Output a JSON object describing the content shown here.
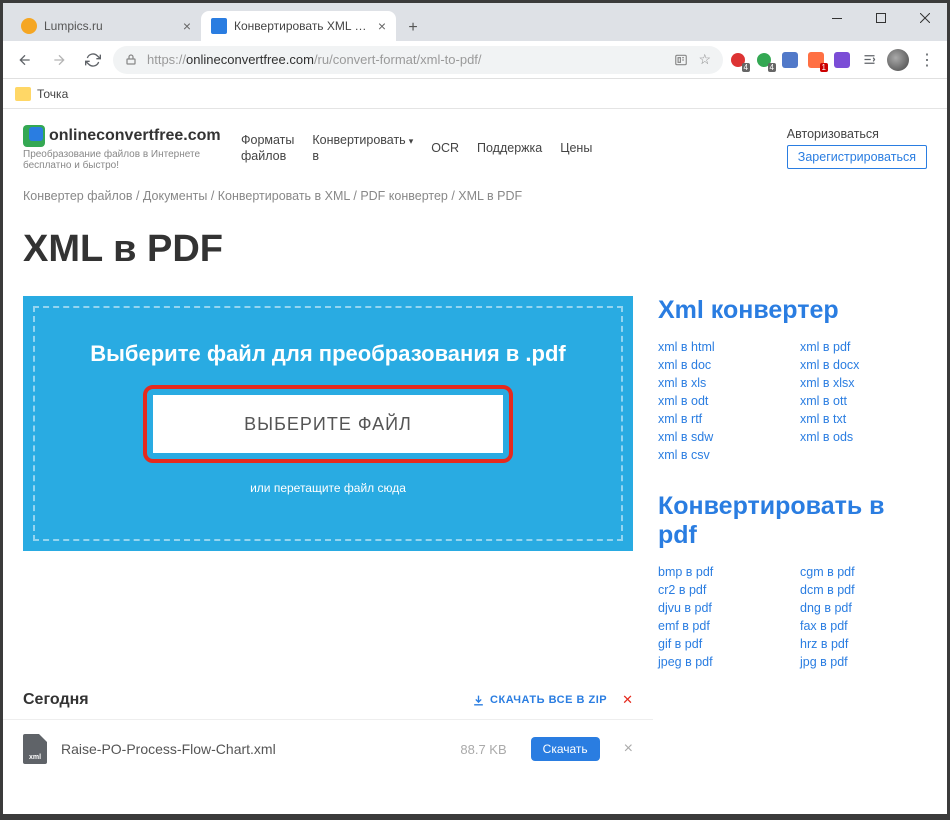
{
  "browser": {
    "tabs": [
      {
        "title": "Lumpics.ru"
      },
      {
        "title": "Конвертировать XML в PDF онл"
      }
    ],
    "url_scheme": "https://",
    "url_host": "onlineconvertfree.com",
    "url_path": "/ru/convert-format/xml-to-pdf/",
    "bookmark": "Точка",
    "ext_badges": {
      "b1": "4",
      "b2": "4",
      "b3": "1"
    }
  },
  "header": {
    "logo": "onlineconvertfree.com",
    "tagline": "Преобразование файлов в Интернете бесплатно и быстро!",
    "nav": {
      "formats1": "Форматы",
      "formats2": "файлов",
      "convert1": "Конвертировать",
      "convert2": "в",
      "ocr": "OCR",
      "support": "Поддержка",
      "prices": "Цены"
    },
    "auth": {
      "login": "Авторизоваться",
      "register": "Зарегистрироваться"
    }
  },
  "crumbs": {
    "c1": "Конвертер файлов",
    "c2": "Документы",
    "c3": "Конвертировать в XML",
    "c4": "PDF конвертер",
    "c5": "XML в PDF"
  },
  "title": "XML в PDF",
  "drop": {
    "title": "Выберите файл для преобразования в .pdf",
    "button": "ВЫБЕРИТЕ ФАЙЛ",
    "hint": "или перетащите файл сюда"
  },
  "xml_conv_title": "Xml конвертер",
  "xml_links": [
    "xml в html",
    "xml в pdf",
    "xml в doc",
    "xml в docx",
    "xml в xls",
    "xml в xlsx",
    "xml в odt",
    "xml в ott",
    "xml в rtf",
    "xml в txt",
    "xml в sdw",
    "xml в ods",
    "xml в csv"
  ],
  "pdf_conv_title": "Конвертировать в pdf",
  "pdf_links": [
    "bmp в pdf",
    "cgm в pdf",
    "cr2 в pdf",
    "dcm в pdf",
    "djvu в pdf",
    "dng в pdf",
    "emf в pdf",
    "fax в pdf",
    "gif в pdf",
    "hrz в pdf",
    "jpeg в pdf",
    "jpg в pdf"
  ],
  "today": {
    "label": "Сегодня",
    "download_all": "СКАЧАТЬ ВСЕ В ZIP",
    "file_name": "Raise-PO-Process-Flow-Chart.xml",
    "file_size": "88.7 KB",
    "file_tag": "xml",
    "download": "Скачать"
  }
}
